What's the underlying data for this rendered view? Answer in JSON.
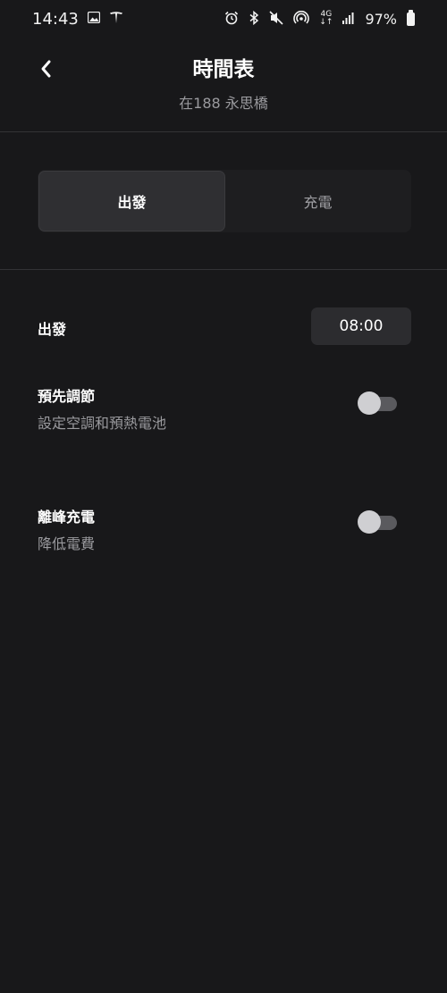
{
  "status_bar": {
    "time": "14:43",
    "network": "4G",
    "battery": "97%"
  },
  "header": {
    "title": "時間表",
    "subtitle": "在188 永思橋"
  },
  "tabs": [
    {
      "label": "出發",
      "active": true
    },
    {
      "label": "充電",
      "active": false
    }
  ],
  "departure": {
    "label": "出發",
    "time": "08:00"
  },
  "preconditioning": {
    "label": "預先調節",
    "description": "設定空調和預熱電池",
    "enabled": false
  },
  "off_peak_charging": {
    "label": "離峰充電",
    "description": "降低電費",
    "enabled": false
  },
  "colors": {
    "background": "#18181a",
    "active_tab": "#2f2f32",
    "muted_text": "#9a9a9e"
  }
}
